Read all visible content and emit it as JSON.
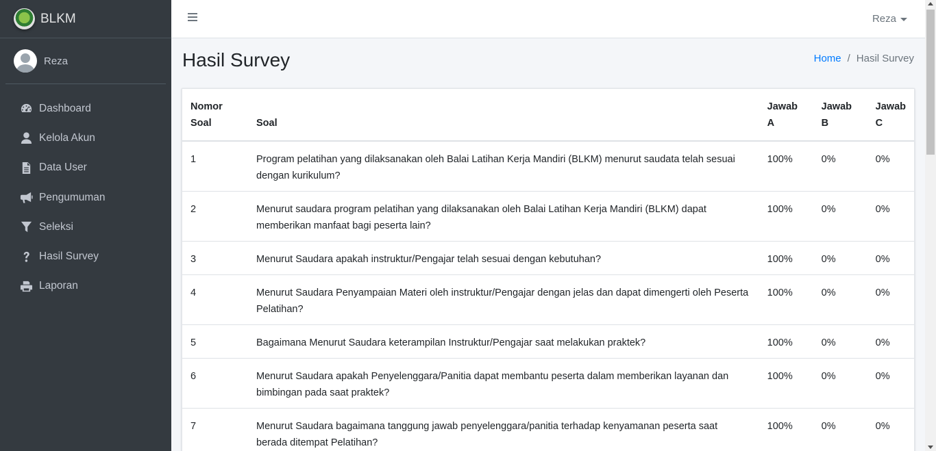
{
  "brand": {
    "name": "BLKM",
    "logo_icon": "regional-seal-logo"
  },
  "user": {
    "name": "Reza"
  },
  "sidebar": {
    "items": [
      {
        "label": "Dashboard",
        "icon": "tachometer-icon"
      },
      {
        "label": "Kelola Akun",
        "icon": "user-icon"
      },
      {
        "label": "Data User",
        "icon": "file-icon"
      },
      {
        "label": "Pengumuman",
        "icon": "bullhorn-icon"
      },
      {
        "label": "Seleksi",
        "icon": "filter-icon"
      },
      {
        "label": "Hasil Survey",
        "icon": "question-icon"
      },
      {
        "label": "Laporan",
        "icon": "print-icon"
      }
    ]
  },
  "topbar": {
    "user_label": "Reza"
  },
  "page": {
    "title": "Hasil Survey"
  },
  "breadcrumb": {
    "home": "Home",
    "separator": "/",
    "current": "Hasil Survey"
  },
  "table": {
    "headers": {
      "nomor_line1": "Nomor",
      "nomor_line2": "Soal",
      "soal": "Soal",
      "jawab_a_line1": "Jawab",
      "jawab_a_line2": "A",
      "jawab_b_line1": "Jawab",
      "jawab_b_line2": "B",
      "jawab_c_line1": "Jawab",
      "jawab_c_line2": "C"
    },
    "rows": [
      {
        "no": "1",
        "soal": "Program pelatihan yang dilaksanakan oleh Balai Latihan Kerja Mandiri (BLKM) menurut saudata telah sesuai dengan kurikulum?",
        "a": "100%",
        "b": "0%",
        "c": "0%"
      },
      {
        "no": "2",
        "soal": "Menurut saudara program pelatihan yang dilaksanakan oleh Balai Latihan Kerja Mandiri (BLKM) dapat memberikan manfaat bagi peserta lain?",
        "a": "100%",
        "b": "0%",
        "c": "0%"
      },
      {
        "no": "3",
        "soal": "Menurut Saudara apakah instruktur/Pengajar telah sesuai dengan kebutuhan?",
        "a": "100%",
        "b": "0%",
        "c": "0%"
      },
      {
        "no": "4",
        "soal": "Menurut Saudara Penyampaian Materi oleh instruktur/Pengajar dengan jelas dan dapat dimengerti oleh Peserta Pelatihan?",
        "a": "100%",
        "b": "0%",
        "c": "0%"
      },
      {
        "no": "5",
        "soal": "Bagaimana Menurut Saudara keterampilan Instruktur/Pengajar saat melakukan praktek?",
        "a": "100%",
        "b": "0%",
        "c": "0%"
      },
      {
        "no": "6",
        "soal": "Menurut Saudara apakah Penyelenggara/Panitia dapat membantu peserta dalam memberikan layanan dan bimbingan pada saat praktek?",
        "a": "100%",
        "b": "0%",
        "c": "0%"
      },
      {
        "no": "7",
        "soal": "Menurut Saudara bagaimana tanggung jawab penyelenggara/panitia terhadap kenyamanan peserta saat berada ditempat Pelatihan?",
        "a": "100%",
        "b": "0%",
        "c": "0%"
      }
    ]
  },
  "colors": {
    "sidebar_bg": "#343a40",
    "link": "#007bff",
    "content_bg": "#f4f6f9"
  }
}
